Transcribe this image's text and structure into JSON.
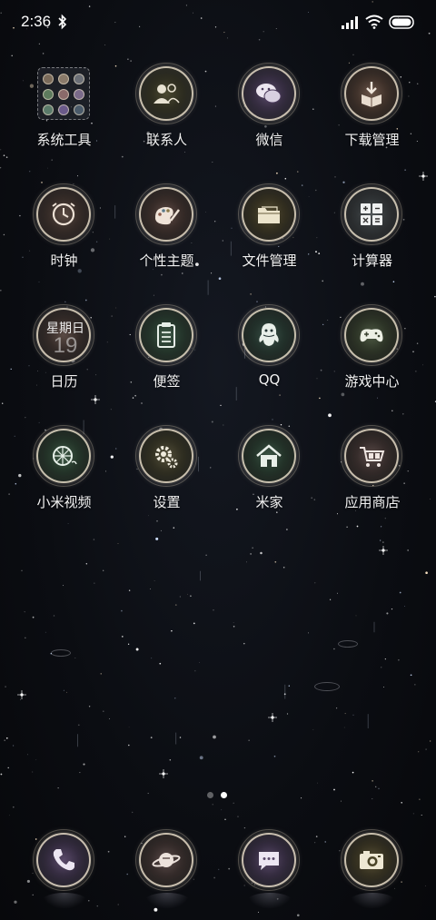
{
  "status_bar": {
    "time": "2:36",
    "icons": [
      "bluetooth-icon",
      "signal-icon",
      "wifi-icon",
      "battery-icon"
    ]
  },
  "apps": [
    {
      "label": "系统工具",
      "icon": "folder-icon"
    },
    {
      "label": "联系人",
      "icon": "contacts-icon"
    },
    {
      "label": "微信",
      "icon": "wechat-icon"
    },
    {
      "label": "下载管理",
      "icon": "download-icon"
    },
    {
      "label": "时钟",
      "icon": "clock-icon"
    },
    {
      "label": "个性主题",
      "icon": "theme-icon"
    },
    {
      "label": "文件管理",
      "icon": "file-icon"
    },
    {
      "label": "计算器",
      "icon": "calculator-icon"
    },
    {
      "label": "日历",
      "icon": "calendar-icon",
      "calendar_day": "星期日",
      "calendar_date": "19"
    },
    {
      "label": "便签",
      "icon": "notes-icon"
    },
    {
      "label": "QQ",
      "icon": "qq-icon"
    },
    {
      "label": "游戏中心",
      "icon": "gamepad-icon"
    },
    {
      "label": "小米视频",
      "icon": "video-icon"
    },
    {
      "label": "设置",
      "icon": "gear-icon"
    },
    {
      "label": "米家",
      "icon": "home-icon"
    },
    {
      "label": "应用商店",
      "icon": "store-icon"
    }
  ],
  "page_indicator": {
    "count": 2,
    "active": 2
  },
  "dock": [
    {
      "icon": "phone-icon"
    },
    {
      "icon": "browser-icon"
    },
    {
      "icon": "messages-icon"
    },
    {
      "icon": "camera-icon"
    }
  ],
  "colors": {
    "background": "#0b0d12",
    "ring": "#e6dcc8",
    "label": "#f2f2f2"
  }
}
